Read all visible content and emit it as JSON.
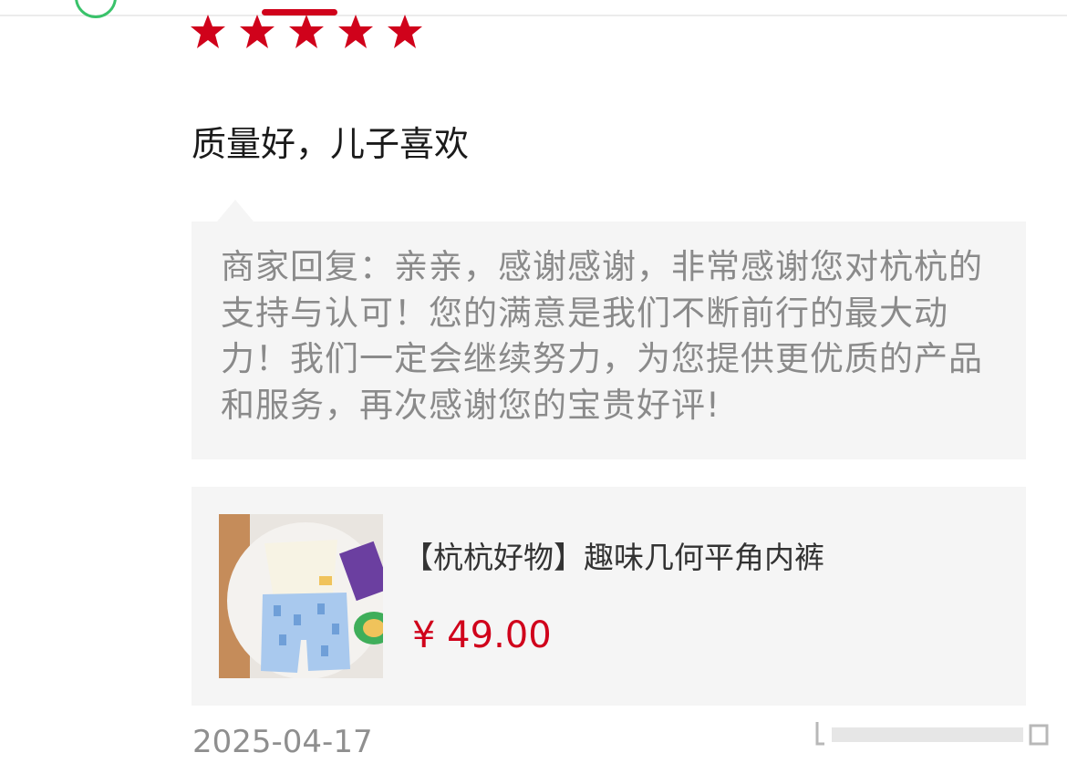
{
  "review": {
    "rating": 5,
    "rating_max": 5,
    "comment": "质量好，儿子喜欢",
    "merchant_reply": "商家回复：亲亲，感谢感谢，非常感谢您对杭杭的支持与认可！您的满意是我们不断前行的最大动力！我们一定会继续努力，为您提供更优质的产品和服务，再次感谢您的宝贵好评!",
    "date": "2025-04-17"
  },
  "product": {
    "name": "【杭杭好物】趣味几何平角内裤",
    "price": "¥ 49.00"
  },
  "colors": {
    "accent": "#d0021b",
    "reply_bg": "#f5f5f5",
    "muted_text": "#8a8a8a"
  },
  "icons": [
    "star-icon",
    "product-thumbnail",
    "action-icons"
  ]
}
